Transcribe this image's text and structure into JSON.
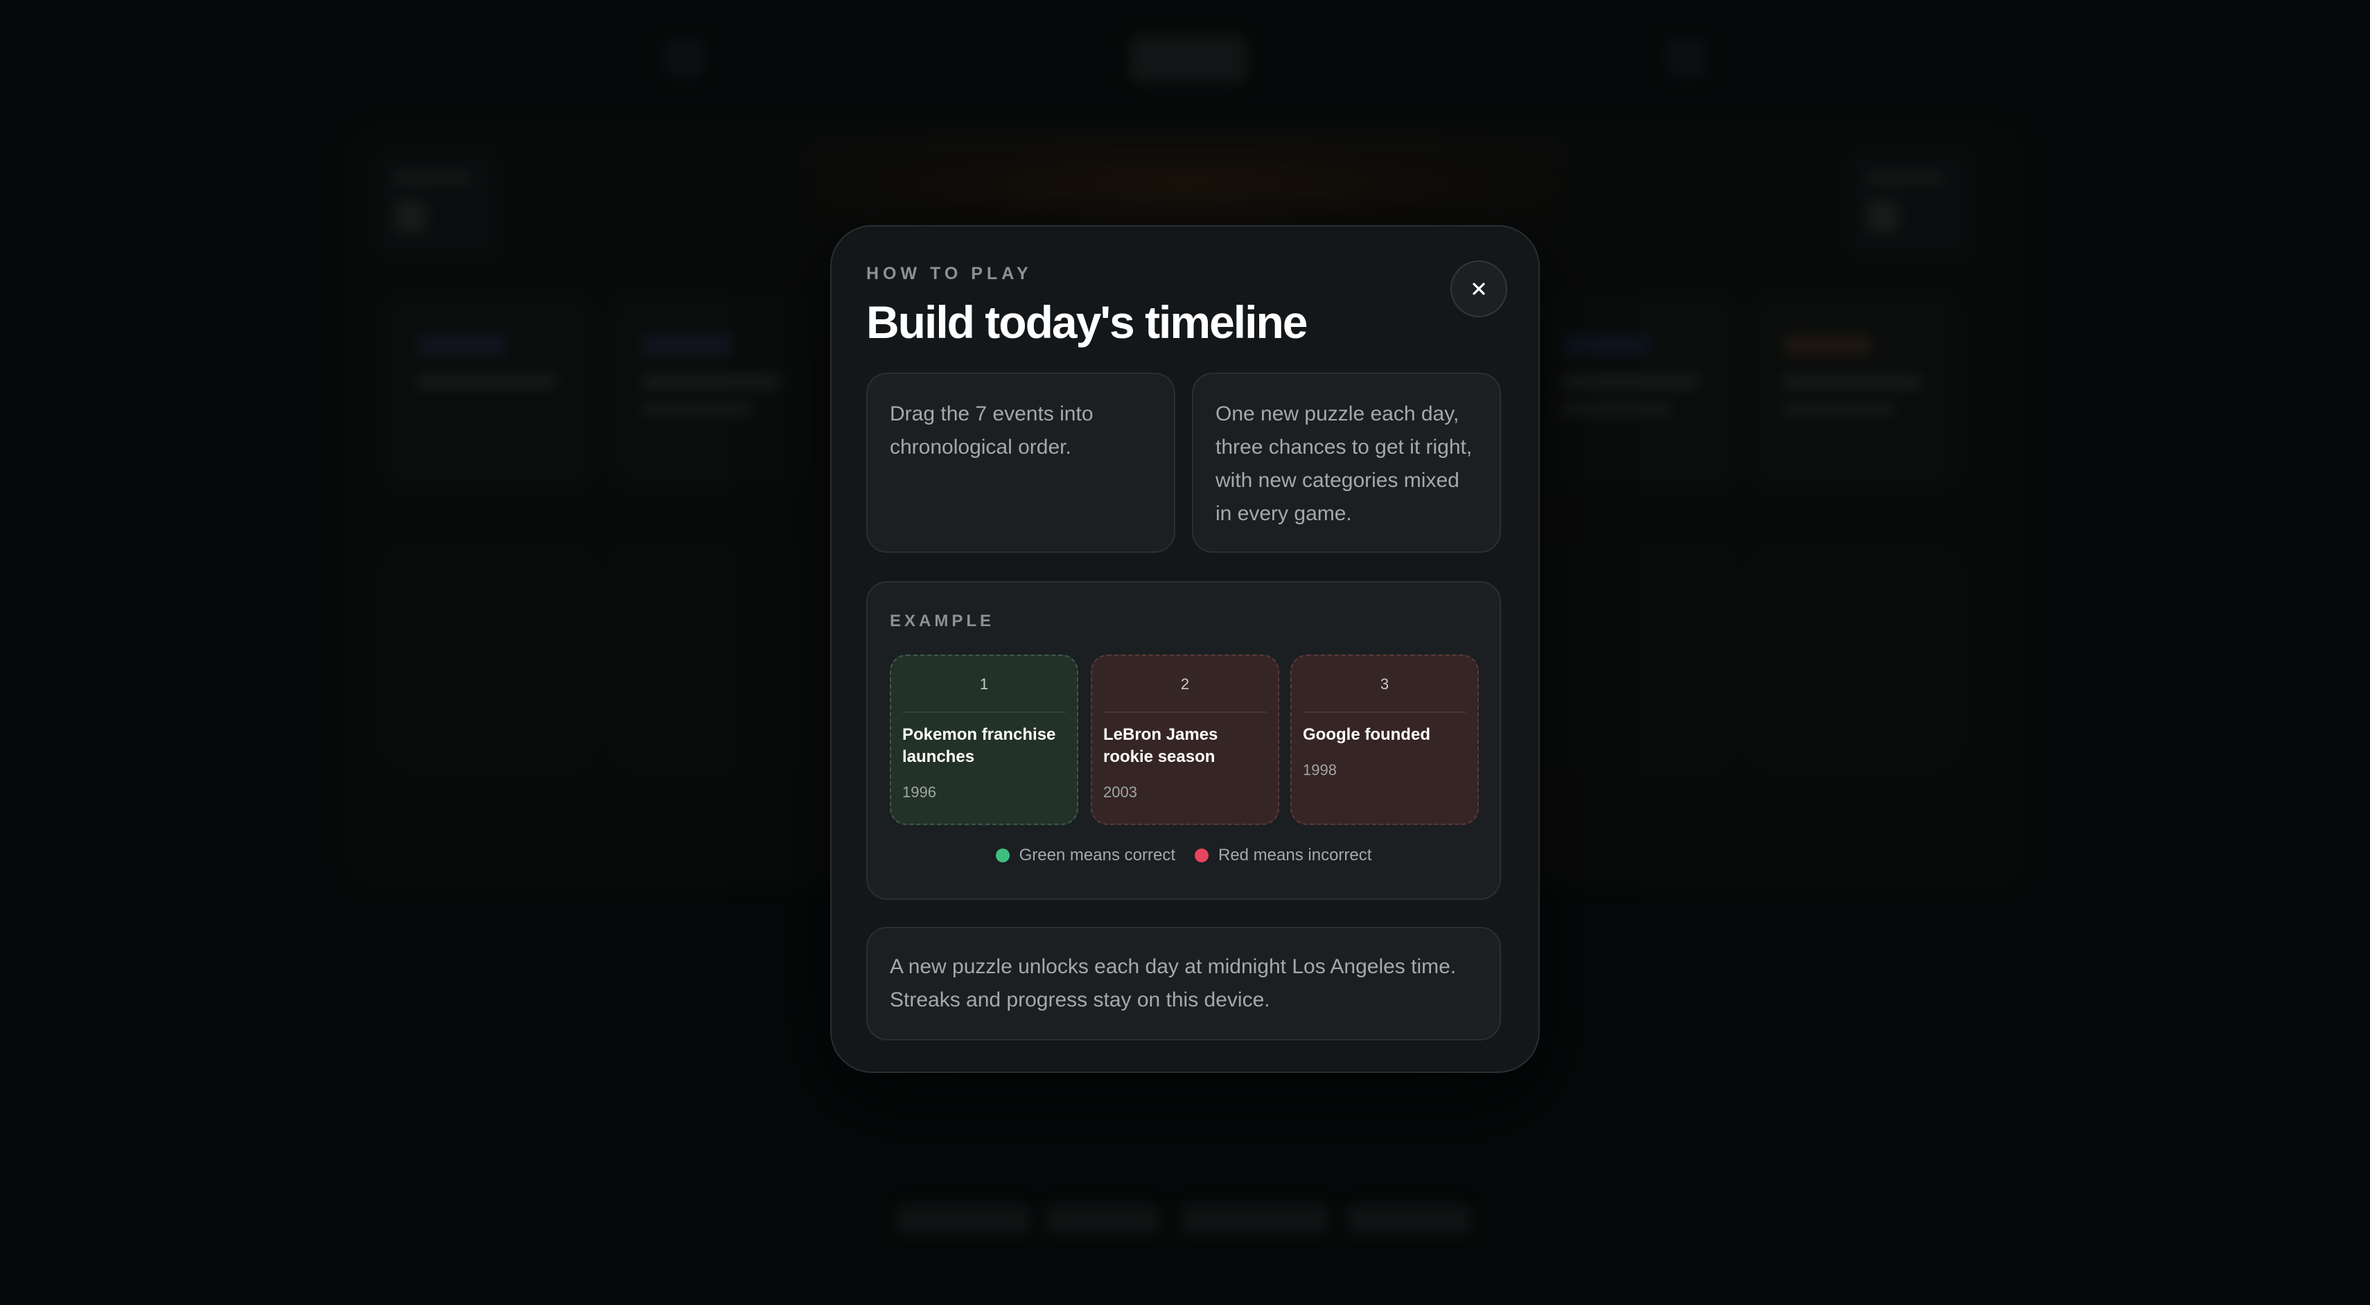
{
  "modal": {
    "eyebrow": "HOW TO PLAY",
    "title": "Build today's timeline",
    "close_icon": "close-icon",
    "info_cards": [
      {
        "text": "Drag the 7 events into chronological order."
      },
      {
        "text": "One new puzzle each day, three chances to get it right, with new categories mixed in every game."
      }
    ],
    "example": {
      "label": "EXAMPLE",
      "cards": [
        {
          "position": "1",
          "name": "Pokemon franchise launches",
          "year": "1996",
          "status": "correct"
        },
        {
          "position": "2",
          "name": "LeBron James rookie season",
          "year": "2003",
          "status": "incorrect"
        },
        {
          "position": "3",
          "name": "Google founded",
          "year": "1998",
          "status": "incorrect"
        }
      ],
      "legend": [
        {
          "label": "Green means correct",
          "color": "#3fbf7f"
        },
        {
          "label": "Red means incorrect",
          "color": "#e5455d"
        }
      ]
    },
    "note": "A new puzzle unlocks each day at midnight Los Angeles time. Streaks and progress stay on this device."
  },
  "colors": {
    "correct_card_bg": "#233229",
    "incorrect_card_bg": "#362525",
    "modal_bg": "#141719",
    "page_bg": "#0a0c0e"
  }
}
